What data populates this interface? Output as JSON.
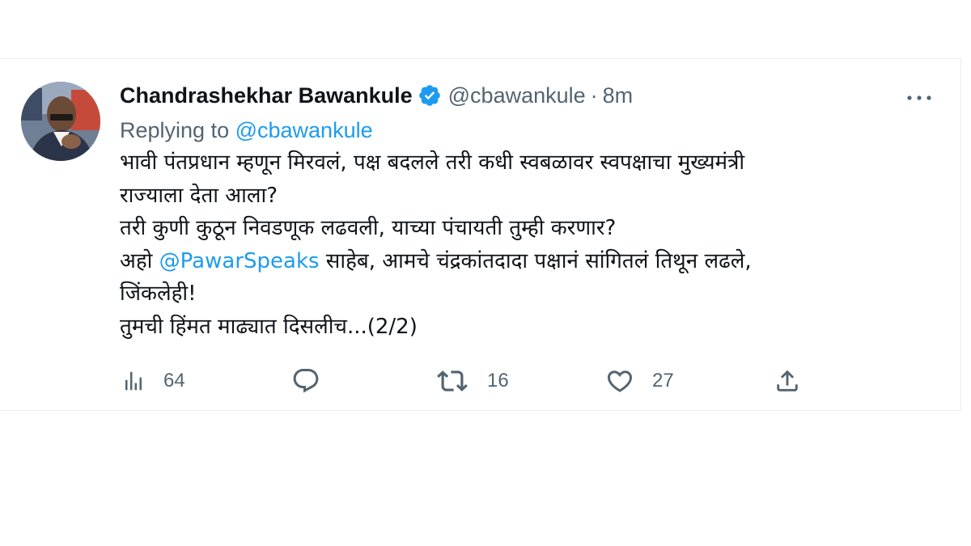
{
  "tweet": {
    "display_name": "Chandrashekhar Bawankule",
    "handle": "@cbawankule",
    "separator": "·",
    "time": "8m",
    "reply_prefix": "Replying to ",
    "reply_to": "@cbawankule",
    "lines": [
      "भावी पंतप्रधान म्हणून मिरवलं, पक्ष बदलले तरी कधी स्वबळावर स्वपक्षाचा मुख्यमंत्री",
      "राज्याला देता आला?",
      "तरी कुणी कुठून निवडणूक लढवली, याच्या पंचायती तुम्ही करणार?"
    ],
    "line4_prefix": "अहो ",
    "line4_mention": "@PawarSpeaks",
    "line4_suffix": " साहेब, आमचे चंद्रकांतदादा पक्षानं सांगितलं तिथून लढले,",
    "line5": "जिंकलेही!",
    "line6": "तुमची हिंमत माढ्यात दिसलीच...(2/2)",
    "stats": {
      "views": "64",
      "replies": "",
      "retweets": "16",
      "likes": "27"
    },
    "icons": {
      "verified": "verified-badge-icon",
      "more": "more-dots-icon",
      "views": "analytics-icon",
      "reply": "reply-bubble-icon",
      "retweet": "retweet-icon",
      "like": "heart-icon",
      "share": "share-icon"
    },
    "colors": {
      "accent": "#1d9bf0",
      "muted": "#536471",
      "text": "#0f1419"
    }
  }
}
